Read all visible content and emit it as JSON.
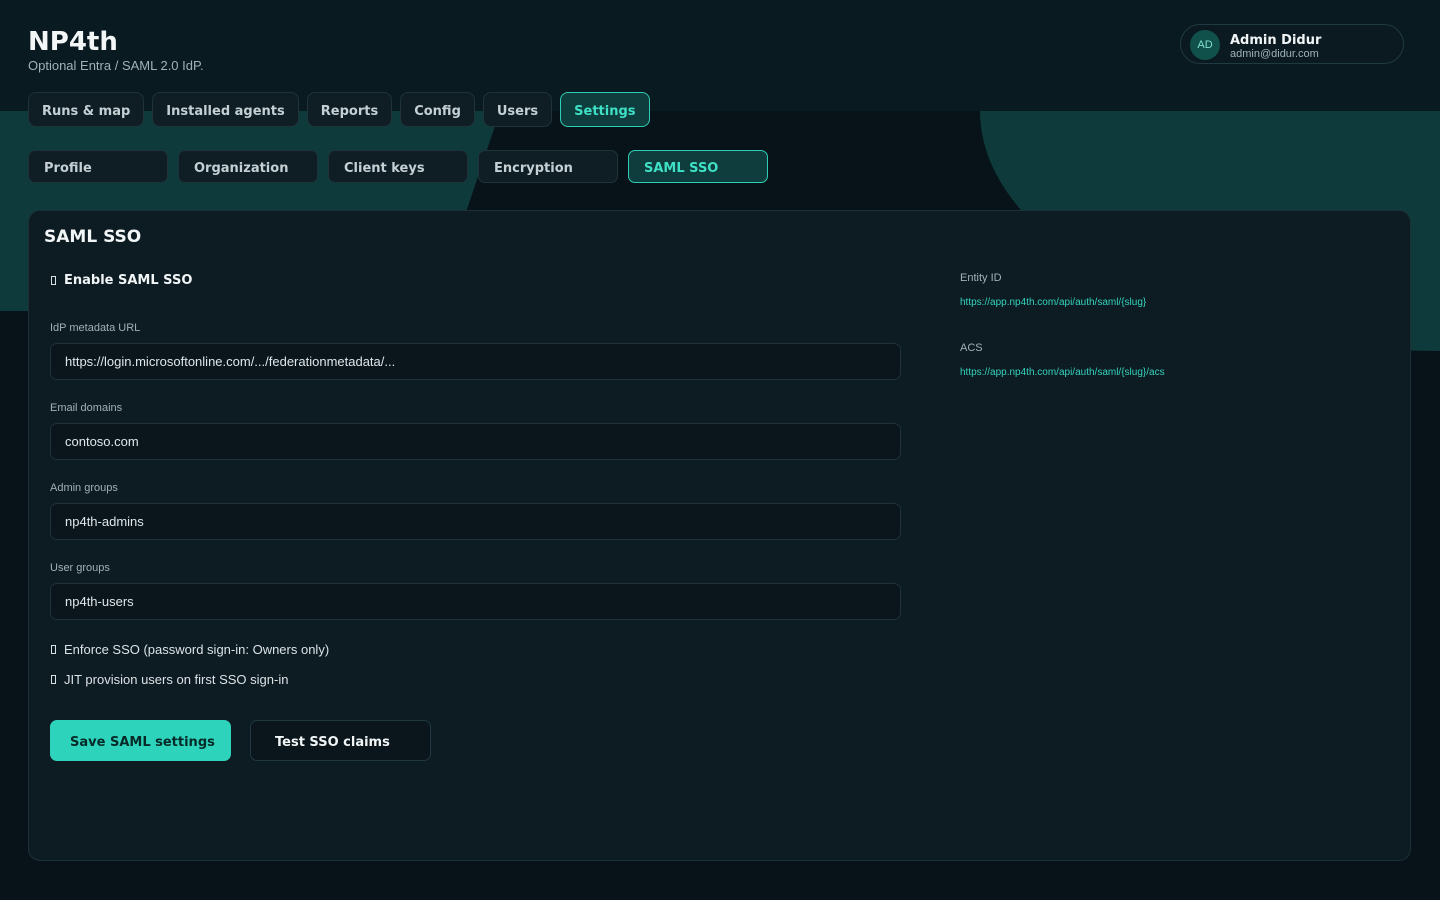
{
  "app": {
    "title": "NP4th",
    "subtitle": "Optional Entra / SAML 2.0 IdP."
  },
  "user": {
    "initials": "AD",
    "name": "Admin Didur",
    "email": "admin@didur.com"
  },
  "main_tabs": [
    {
      "label": "Runs & map"
    },
    {
      "label": "Installed agents"
    },
    {
      "label": "Reports"
    },
    {
      "label": "Config"
    },
    {
      "label": "Users"
    },
    {
      "label": "Settings",
      "active": true
    }
  ],
  "sub_tabs": [
    {
      "label": "Profile"
    },
    {
      "label": "Organization"
    },
    {
      "label": "Client keys"
    },
    {
      "label": "Encryption"
    },
    {
      "label": "SAML SSO",
      "active": true
    }
  ],
  "panel": {
    "title": "SAML SSO",
    "enable_label": "Enable SAML SSO",
    "fields": {
      "metadata_url": {
        "label": "IdP metadata URL",
        "value": "https://login.microsoftonline.com/.../federationmetadata/..."
      },
      "email_domains": {
        "label": "Email domains",
        "value": "contoso.com"
      },
      "admin_groups": {
        "label": "Admin groups",
        "value": "np4th-admins"
      },
      "user_groups": {
        "label": "User groups",
        "value": "np4th-users"
      }
    },
    "enforce_label": "Enforce SSO (password sign-in: Owners only)",
    "jit_label": "JIT provision users on first SSO sign-in",
    "save_label": "Save SAML settings",
    "test_label": "Test SSO claims",
    "entity_id": {
      "label": "Entity ID",
      "value": "https://app.np4th.com/api/auth/saml/{slug}"
    },
    "acs": {
      "label": "ACS",
      "value": "https://app.np4th.com/api/auth/saml/{slug}/acs"
    }
  },
  "colors": {
    "accent": "#2ed3bc",
    "background": "#081319",
    "panel": "#0d1b22"
  }
}
